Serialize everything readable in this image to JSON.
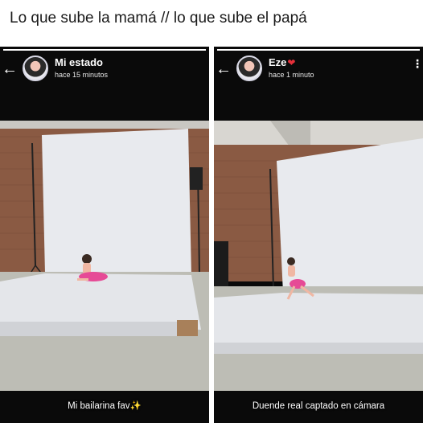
{
  "meme": {
    "caption": "Lo que sube la mamá // lo que sube el papá"
  },
  "stories": [
    {
      "user_name": "Mi estado",
      "has_heart": false,
      "time_ago": "hace 15 minutos",
      "caption": "Mi bailarina fav✨",
      "back_icon": "back-arrow-icon",
      "progress": 1.0
    },
    {
      "user_name": "Eze",
      "has_heart": true,
      "time_ago": "hace 1 minuto",
      "caption": "Duende real captado en cámara",
      "back_icon": "back-arrow-icon",
      "more_icon": "more-vert-icon",
      "progress": 1.0
    }
  ],
  "colors": {
    "background": "#ffffff",
    "story_bg": "#0a0a0a",
    "backdrop": "#e8eaee",
    "brick": "#8a5a43",
    "floor": "#bdbdb5",
    "heart": "#e5303a"
  }
}
